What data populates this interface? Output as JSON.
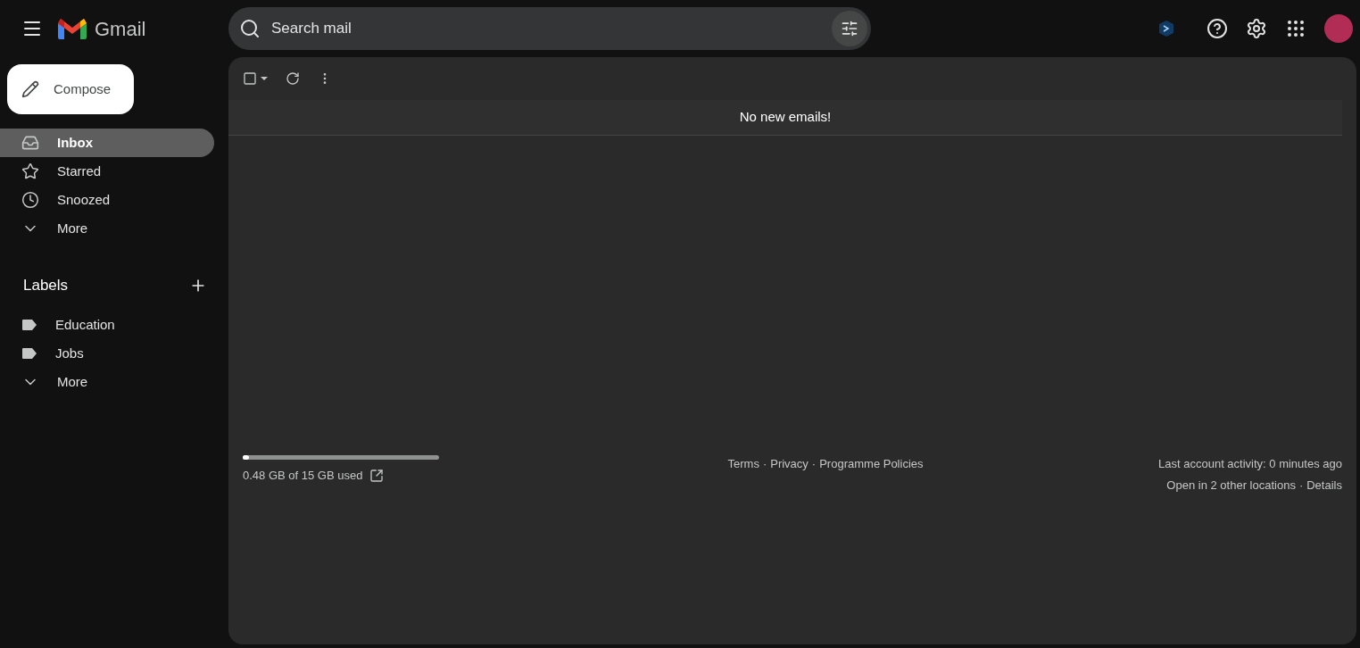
{
  "app": {
    "name": "Gmail"
  },
  "search": {
    "placeholder": "Search mail"
  },
  "compose": {
    "label": "Compose"
  },
  "nav": [
    {
      "kind": "inbox",
      "label": "Inbox",
      "selected": true
    },
    {
      "kind": "starred",
      "label": "Starred",
      "selected": false
    },
    {
      "kind": "snoozed",
      "label": "Snoozed",
      "selected": false
    },
    {
      "kind": "more",
      "label": "More",
      "selected": false
    }
  ],
  "labels": {
    "title": "Labels",
    "items": [
      {
        "kind": "label",
        "label": "Education"
      },
      {
        "kind": "label",
        "label": "Jobs"
      },
      {
        "kind": "more",
        "label": "More"
      }
    ]
  },
  "message_list": {
    "empty_text": "No new emails!"
  },
  "footer": {
    "storage": {
      "level": 0.03,
      "text": "0.48 GB of 15 GB used"
    },
    "links": [
      "Terms",
      "Privacy",
      "Programme Policies"
    ],
    "separator": "·",
    "activity": "Last account activity: 0 minutes ago",
    "locations": "Open in 2 other locations",
    "details": "Details"
  }
}
